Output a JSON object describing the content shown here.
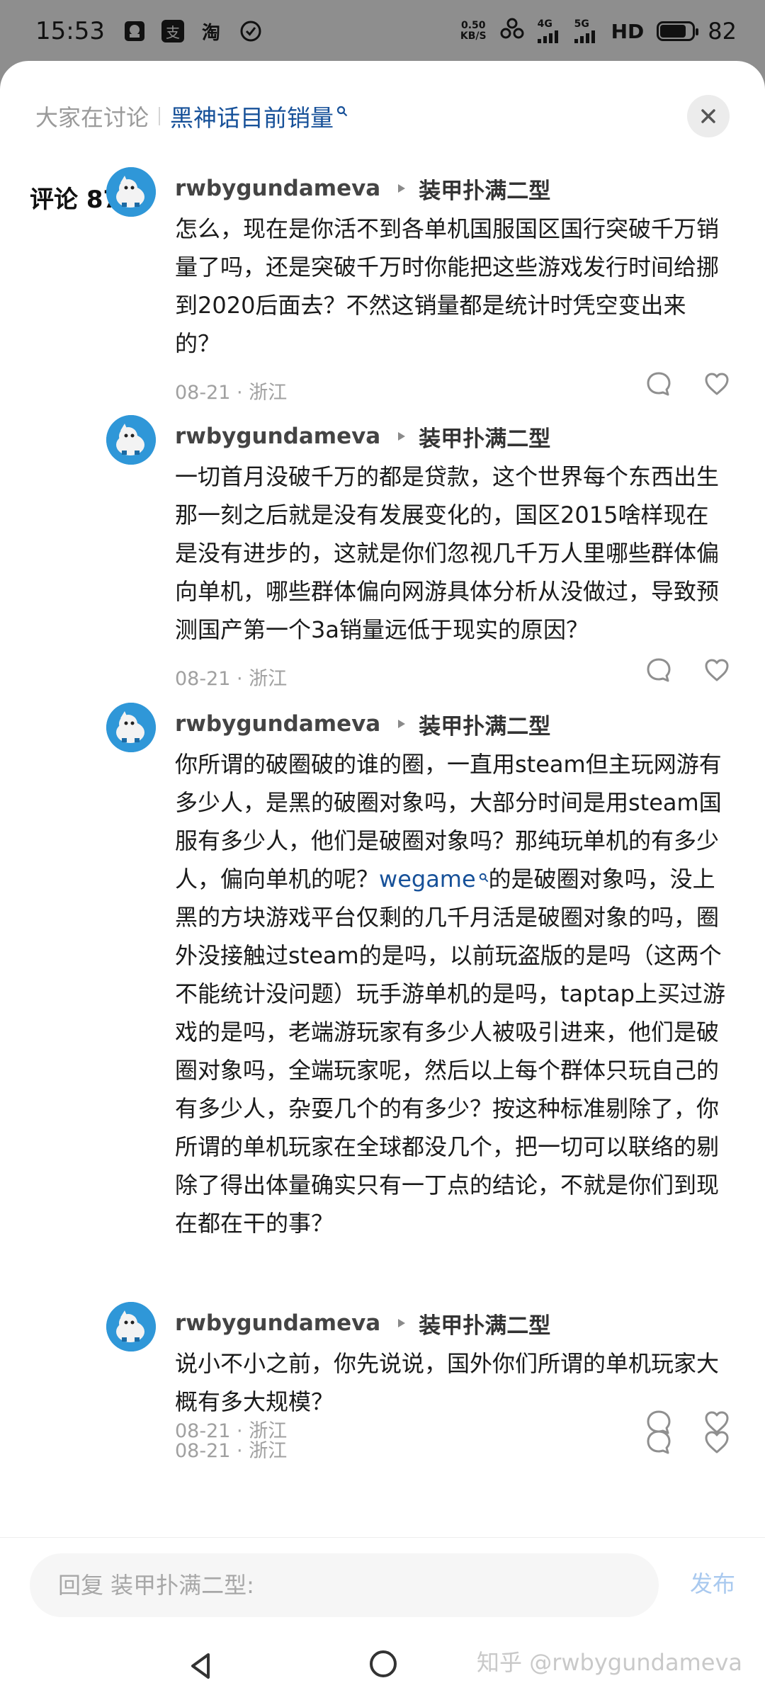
{
  "status_bar": {
    "time": "15:53",
    "app_icons": [
      "notification-icon",
      "alipay-icon",
      "taobao-icon",
      "check-circle-icon"
    ],
    "app_icon_glyphs": [
      "",
      "支",
      "淘",
      ""
    ],
    "net_speed_value": "0.50",
    "net_speed_unit": "KB/S",
    "signal_labels": [
      "4G",
      "5G"
    ],
    "hd_label": "HD",
    "battery_level": 82,
    "battery_text": "82"
  },
  "topic": {
    "prefix": "大家在讨论",
    "link": "黑神话目前销量"
  },
  "comments_header": "评论 87",
  "comments": [
    {
      "author": "rwbygundameva",
      "reply_to": "装甲扑满二型",
      "text": "怎么，现在是你活不到各单机国服国区国行突破千万销量了吗，还是突破千万时你能把这些游戏发行时间给挪到2020后面去？不然这销量都是统计时凭空变出来的？",
      "meta": "08-21 · 浙江"
    },
    {
      "author": "rwbygundameva",
      "reply_to": "装甲扑满二型",
      "text": "一切首月没破千万的都是贷款，这个世界每个东西出生那一刻之后就是没有发展变化的，国区2015啥样现在是没有进步的，这就是你们忽视几千万人里哪些群体偏向单机，哪些群体偏向网游具体分析从没做过，导致预测国产第一个3a销量远低于现实的原因？",
      "meta": "08-21 · 浙江"
    },
    {
      "author": "rwbygundameva",
      "reply_to": "装甲扑满二型",
      "text_before": "你所谓的破圈破的谁的圈，一直用steam但主玩网游有多少人，是黑的破圈对象吗，大部分时间是用steam国服有多少人，他们是破圈对象吗？那纯玩单机的有多少人，偏向单机的呢？",
      "link_text": "wegame",
      "text_after": "的是破圈对象吗，没上黑的方块游戏平台仅剩的几千月活是破圈对象的吗，圈外没接触过steam的是吗，以前玩盗版的是吗（这两个不能统计没问题）玩手游单机的是吗，taptap上买过游戏的是吗，老端游玩家有多少人被吸引进来，他们是破圈对象吗，全端玩家呢，然后以上每个群体只玩自己的有多少人，杂耍几个的有多少？按这种标准剔除了，你所谓的单机玩家在全球都没几个，把一切可以联络的剔除了得出体量确实只有一丁点的结论，不就是你们到现在都在干的事？",
      "meta": "08-21 · 浙江"
    },
    {
      "author": "rwbygundameva",
      "reply_to": "装甲扑满二型",
      "text": "说小不小之前，你先说说，国外你们所谓的单机玩家大概有多大规模？",
      "meta": "08-21 · 浙江"
    }
  ],
  "reply": {
    "placeholder": "回复 装甲扑满二型:",
    "send_label": "发布"
  },
  "watermark": "知乎 @rwbygundameva",
  "colors": {
    "link": "#175199",
    "send_disabled": "#a9c9ef",
    "avatar_bg": "#2f97d8",
    "status_bar_bg": "#8e8e8e"
  }
}
